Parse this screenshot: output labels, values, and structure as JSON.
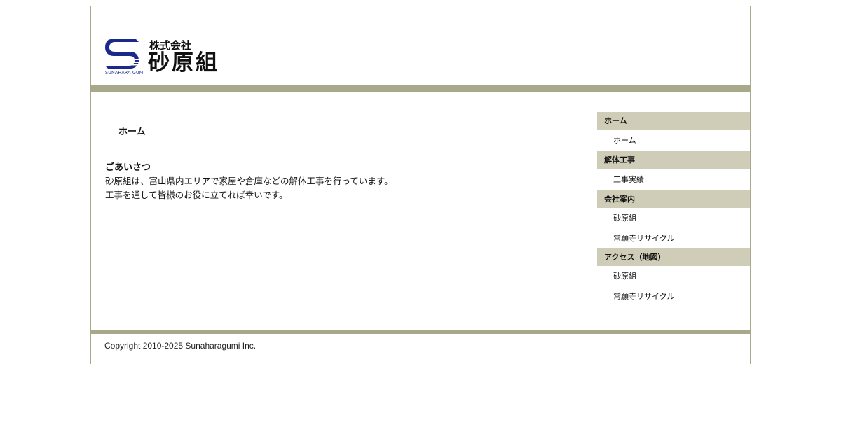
{
  "header": {
    "logo_mark_text": "SUNAHARA GUMI",
    "company_type": "株式会社",
    "company_name": "砂原組",
    "brand_color": "#1a2a8c"
  },
  "main": {
    "page_title": "ホーム",
    "greeting": {
      "heading": "ごあいさつ",
      "lines": [
        "砂原組は、富山県内エリアで家屋や倉庫などの解体工事を行っています。",
        "工事を通して皆様のお役に立てれば幸いです。"
      ]
    }
  },
  "sidebar": {
    "sections": [
      {
        "heading": "ホーム",
        "links": [
          "ホーム"
        ]
      },
      {
        "heading": "解体工事",
        "links": [
          "工事実績"
        ]
      },
      {
        "heading": "会社案内",
        "links": [
          "砂原組",
          "常願寺リサイクル"
        ]
      },
      {
        "heading": "アクセス（地図）",
        "links": [
          "砂原組",
          "常願寺リサイクル"
        ]
      }
    ]
  },
  "footer": {
    "copyright": "Copyright 2010-2025 Sunaharagumi Inc."
  },
  "colors": {
    "frame": "#a8a98a",
    "sidebar_heading_bg": "#cfcdb8"
  }
}
